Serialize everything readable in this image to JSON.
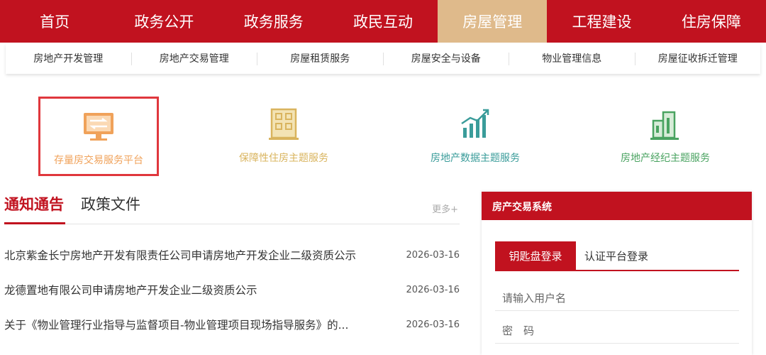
{
  "nav": {
    "items": [
      {
        "label": "首页"
      },
      {
        "label": "政务公开"
      },
      {
        "label": "政务服务"
      },
      {
        "label": "政民互动"
      },
      {
        "label": "房屋管理"
      },
      {
        "label": "工程建设"
      },
      {
        "label": "住房保障"
      }
    ],
    "active_index": 4,
    "bg_color": "#c1121f",
    "active_color": "#dfba8b"
  },
  "subnav": {
    "items": [
      {
        "label": "房地产开发管理"
      },
      {
        "label": "房地产交易管理"
      },
      {
        "label": "房屋租赁服务"
      },
      {
        "label": "房屋安全与设备"
      },
      {
        "label": "物业管理信息"
      },
      {
        "label": "房屋征收拆迁管理"
      }
    ]
  },
  "services": [
    {
      "label": "存量房交易服务平台",
      "icon": "monitor-transfer-icon",
      "color": "#f0a25a"
    },
    {
      "label": "保障性住房主题服务",
      "icon": "building-icon",
      "color": "#d9b45e"
    },
    {
      "label": "房地产数据主题服务",
      "icon": "bar-chart-trend-icon",
      "color": "#3a9c9a"
    },
    {
      "label": "房地产经纪主题服务",
      "icon": "buildings-icon",
      "color": "#4aa361"
    }
  ],
  "news": {
    "tabs": [
      {
        "label": "通知通告"
      },
      {
        "label": "政策文件"
      }
    ],
    "more": "更多+",
    "items": [
      {
        "title": "北京紫金长宁房地产开发有限责任公司申请房地产开发企业二级资质公示",
        "date": "2026-03-16"
      },
      {
        "title": "龙德置地有限公司申请房地产开发企业二级资质公示",
        "date": "2026-03-16"
      },
      {
        "title": "关于《物业管理行业指导与监督项目-物业管理项目现场指导服务》的...",
        "date": "2026-03-16"
      }
    ]
  },
  "login": {
    "title": "房产交易系统",
    "tabs": [
      {
        "label": "钥匙盘登录"
      },
      {
        "label": "认证平台登录"
      }
    ],
    "username_placeholder": "请输入用户名",
    "password_placeholder": "密　码"
  }
}
